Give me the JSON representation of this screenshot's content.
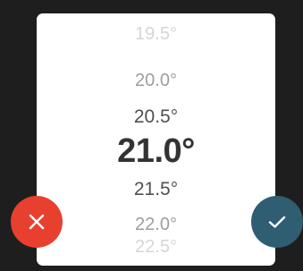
{
  "picker": {
    "values": [
      "19.5°",
      "20.0°",
      "20.5°",
      "21.0°",
      "21.5°",
      "22.0°",
      "22.5°"
    ],
    "selected": "21.0°"
  },
  "buttons": {
    "cancel_icon": "close-icon",
    "confirm_icon": "check-icon"
  },
  "colors": {
    "background": "#1e1e1e",
    "card": "#ffffff",
    "cancel": "#e8402f",
    "confirm": "#2f5d72",
    "selected_text": "#333333"
  }
}
